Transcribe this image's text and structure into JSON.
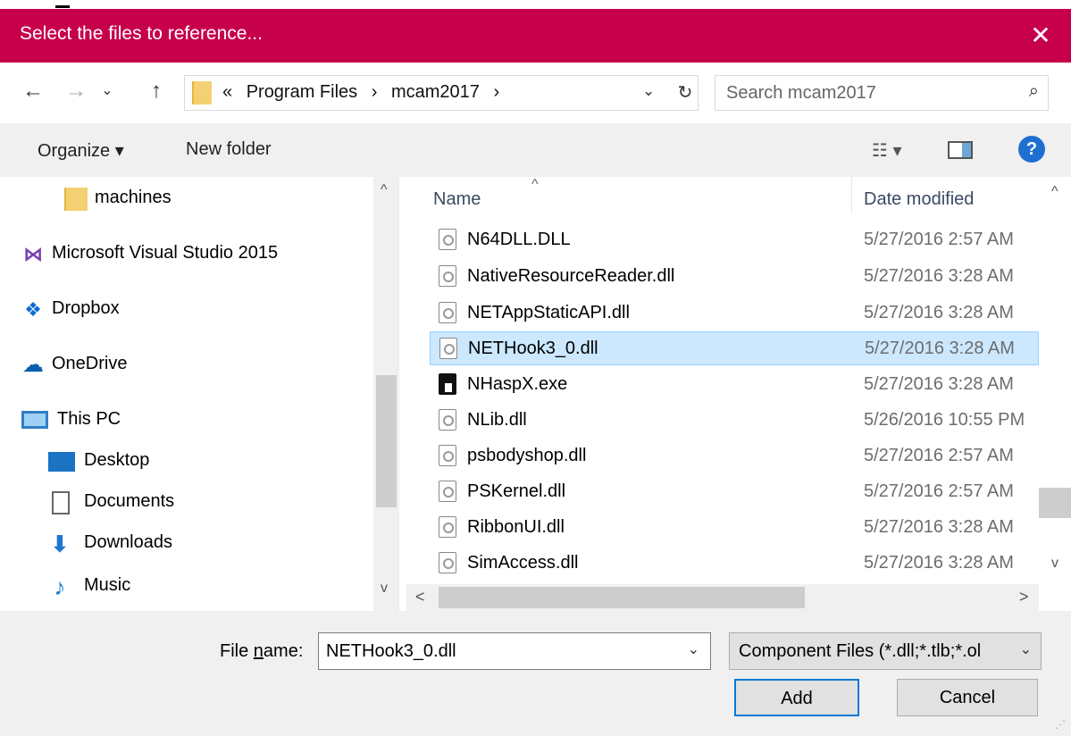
{
  "window": {
    "title": "Select the files to reference...",
    "close_glyph": "✕"
  },
  "nav": {
    "back_glyph": "←",
    "forward_glyph": "→",
    "recent_glyph": "⌄",
    "up_glyph": "↑",
    "breadcrumb_overflow": "«",
    "breadcrumbs": [
      "Program Files",
      "mcam2017"
    ],
    "crumb_sep": "›",
    "address_dropdown_glyph": "⌄",
    "refresh_glyph": "↻",
    "search_placeholder": "Search mcam2017",
    "search_glyph": "⌕"
  },
  "toolbar": {
    "organize_label": "Organize ▾",
    "new_folder_label": "New folder",
    "view_glyph": "☷ ▾",
    "help_glyph": "?"
  },
  "sidebar": {
    "items": [
      {
        "label": "machines",
        "icon": "folder-icon"
      },
      {
        "label": "Microsoft Visual Studio 2015",
        "icon": "visual-studio-icon"
      },
      {
        "label": "Dropbox",
        "icon": "dropbox-icon"
      },
      {
        "label": "OneDrive",
        "icon": "onedrive-icon"
      },
      {
        "label": "This PC",
        "icon": "computer-icon"
      },
      {
        "label": "Desktop",
        "icon": "desktop-icon"
      },
      {
        "label": "Documents",
        "icon": "documents-icon"
      },
      {
        "label": "Downloads",
        "icon": "downloads-icon"
      },
      {
        "label": "Music",
        "icon": "music-icon"
      }
    ],
    "scroll_up_glyph": "^",
    "scroll_down_glyph": "v"
  },
  "files": {
    "columns": {
      "name": "Name",
      "date": "Date modified"
    },
    "sort_glyph": "^",
    "rows": [
      {
        "name": "N64DLL.DLL",
        "date": "5/27/2016 2:57 AM",
        "type": "dll"
      },
      {
        "name": "NativeResourceReader.dll",
        "date": "5/27/2016 3:28 AM",
        "type": "dll"
      },
      {
        "name": "NETAppStaticAPI.dll",
        "date": "5/27/2016 3:28 AM",
        "type": "dll"
      },
      {
        "name": "NETHook3_0.dll",
        "date": "5/27/2016 3:28 AM",
        "type": "dll",
        "selected": true
      },
      {
        "name": "NHaspX.exe",
        "date": "5/27/2016 3:28 AM",
        "type": "exe"
      },
      {
        "name": "NLib.dll",
        "date": "5/26/2016 10:55 PM",
        "type": "dll"
      },
      {
        "name": "psbodyshop.dll",
        "date": "5/27/2016 2:57 AM",
        "type": "dll"
      },
      {
        "name": "PSKernel.dll",
        "date": "5/27/2016 2:57 AM",
        "type": "dll"
      },
      {
        "name": "RibbonUI.dll",
        "date": "5/27/2016 3:28 AM",
        "type": "dll"
      },
      {
        "name": "SimAccess.dll",
        "date": "5/27/2016 3:28 AM",
        "type": "dll"
      }
    ],
    "scroll_up_glyph": "^",
    "scroll_down_glyph": "v",
    "scroll_left_glyph": "<",
    "scroll_right_glyph": ">"
  },
  "bottom": {
    "file_name_label_pre": "File ",
    "file_name_label_u": "n",
    "file_name_label_post": "ame:",
    "file_name_value": "NETHook3_0.dll",
    "file_name_dropdown_glyph": "⌄",
    "filter_value": "Component Files (*.dll;*.tlb;*.ol",
    "filter_dropdown_glyph": "⌄",
    "add_label": "Add",
    "cancel_label": "Cancel",
    "grip_glyph": "⋰"
  },
  "colors": {
    "titlebar": "#c7004c",
    "selection": "#cce8ff",
    "accent": "#0078d7"
  }
}
